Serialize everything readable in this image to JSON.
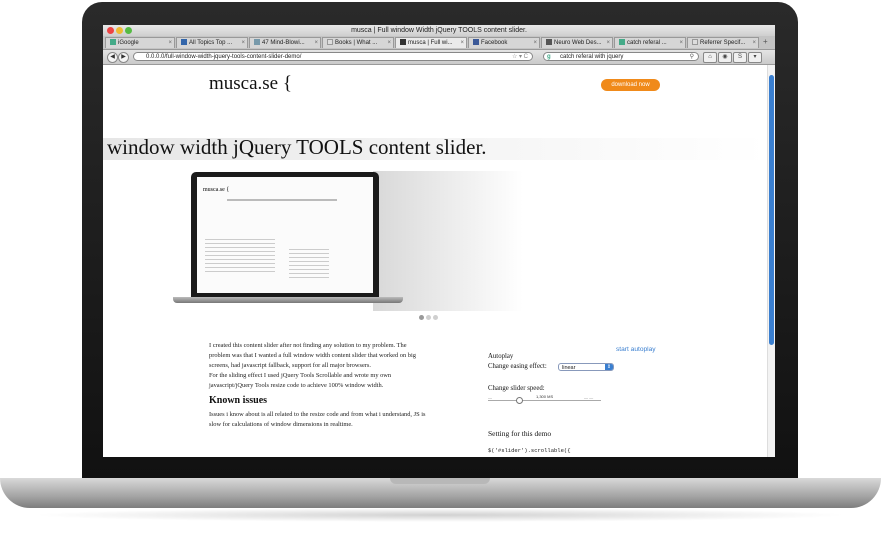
{
  "window": {
    "title": "musca | Full window Width jQuery TOOLS content slider."
  },
  "tabs": [
    {
      "label": "iGoogle",
      "icon": "google-icon",
      "active": false
    },
    {
      "label": "All Topics Top ...",
      "icon": "topics-icon",
      "active": false
    },
    {
      "label": "47 Mind-Blowi...",
      "icon": "page-icon",
      "active": false
    },
    {
      "label": "Books | What ...",
      "icon": "page-icon",
      "active": false
    },
    {
      "label": "musca | Full wi...",
      "icon": "musca-icon",
      "active": true
    },
    {
      "label": "Facebook",
      "icon": "facebook-icon",
      "active": false
    },
    {
      "label": "Neuro Web Des...",
      "icon": "page-icon",
      "active": false
    },
    {
      "label": "catch referal ...",
      "icon": "google-icon",
      "active": false
    },
    {
      "label": "Referrer Specif...",
      "icon": "page-icon",
      "active": false
    }
  ],
  "new_tab_label": "+",
  "navbar": {
    "url": "0.0.0.0/full-window-width-jquery-tools-content-slider-demo/",
    "search_value": "catch referal with jquery"
  },
  "page": {
    "logo": "musca.se {",
    "download_label": "download now",
    "hero_title": "window width jQuery TOOLS content slider.",
    "mini_logo": "musca.se {",
    "intro": [
      "I created this content slider after not finding any solution to my problem. The",
      "problem was that I wanted a full window width content slider that worked on big",
      "screens, had javascript fallback, support for all major browsers.",
      "For the sliding effect I used jQuery Tools Scrollable and wrote my own",
      "javascript/jQuery Tools resize code to achieve 100% window width."
    ],
    "known_issues_heading": "Known issues",
    "issues": [
      "Issues i know about is all related to the resize code and from what i understand, JS is",
      "slow for calculations of window dimensions in realtime."
    ],
    "settings": {
      "start_autoplay": "start autoplay",
      "autoplay_label": "Autoplay",
      "easing_label": "Change easing effect:",
      "easing_value": "linear",
      "speed_label": "Change slider speed:",
      "speed_value": "1,300 MS",
      "demo_heading": "Setting for this demo",
      "code_line": "$('#slider').scrollable({"
    }
  },
  "colors": {
    "accent": "#f08a1a",
    "link": "#3a7fd0"
  }
}
